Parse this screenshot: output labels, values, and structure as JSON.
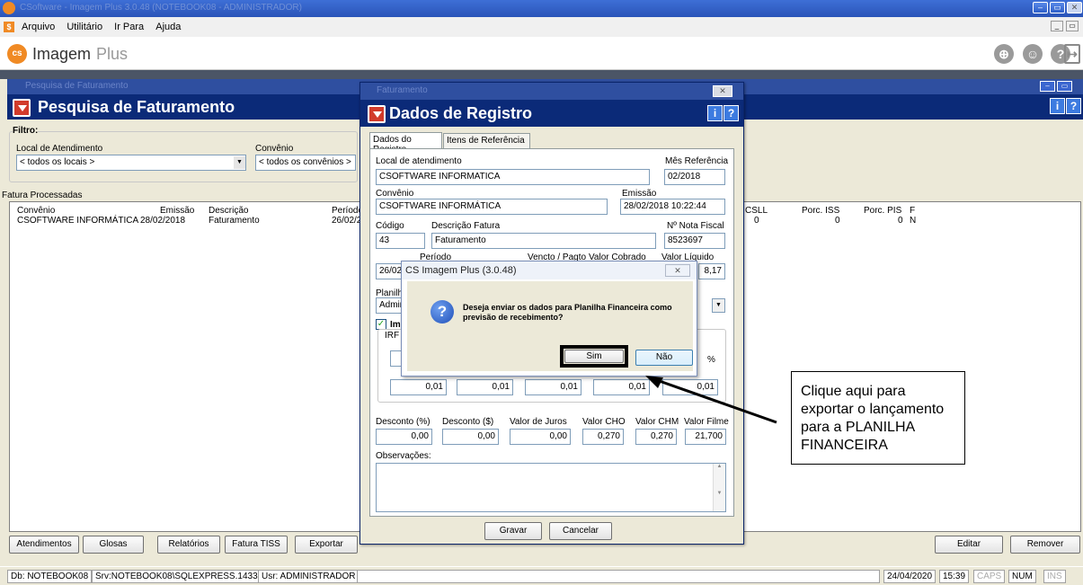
{
  "app": {
    "title": "CSoftware - Imagem Plus 3.0.48 (NOTEBOOK08 - ADMINISTRADOR)",
    "menu": [
      "Arquivo",
      "Utilitário",
      "Ir Para",
      "Ajuda"
    ],
    "brand": "Imagem",
    "brand_suffix": "Plus",
    "brand_logo": "cs"
  },
  "main_window": {
    "window_title": "Pesquisa de Faturamento",
    "header": "Pesquisa de Faturamento",
    "filter_label": "Filtro:",
    "local_label": "Local de Atendimento",
    "local_value": "< todos os locais >",
    "convenio_label": "Convênio",
    "convenio_value": "< todos os convênios >",
    "grid_title": "Fatura Processadas",
    "columns_left": [
      "Convênio",
      "Emissão",
      "Descrição",
      "Período"
    ],
    "columns_right": [
      "CSLL",
      "Porc. ISS",
      "Porc. PIS",
      "F"
    ],
    "row_left": [
      "CSOFTWARE INFORMÁTICA",
      "28/02/2018",
      "Faturamento",
      "26/02/2"
    ],
    "row_right": [
      "0",
      "0",
      "0",
      "N"
    ],
    "buttons_left": [
      "Atendimentos",
      "Glosas",
      "Relatórios",
      "Fatura TISS",
      "Exportar"
    ],
    "buttons_right": [
      "Editar",
      "Remover"
    ]
  },
  "dialog": {
    "window_title": "Faturamento",
    "header": "Dados de Registro",
    "tabs": [
      "Dados do Registro",
      "Itens de Referência"
    ],
    "local_label": "Local de atendimento",
    "local_value": "CSOFTWARE INFORMATICA",
    "mes_label": "Mês Referência",
    "mes_value": "02/2018",
    "convenio_label": "Convênio",
    "convenio_value": "CSOFTWARE INFORMÁTICA",
    "emissao_label": "Emissão",
    "emissao_value": "28/02/2018 10:22:44",
    "codigo_label": "Código",
    "codigo_value": "43",
    "descricao_label": "Descrição Fatura",
    "descricao_value": "Faturamento",
    "nf_label": "Nº Nota Fiscal",
    "nf_value": "8523697",
    "periodo_label": "Período",
    "vencto_label": "Vencto / Pagto",
    "cobrado_label": "Valor Cobrado",
    "liquido_label": "Valor Líquido",
    "periodo_value": "26/02/",
    "liquido_value": "8,17",
    "planilha_label": "Planilha",
    "planilha_value": "Admini",
    "imposto_label": "Im",
    "irrf_label": "IRF",
    "pct_symbol": "%",
    "tax_values": [
      "0,01",
      "0,01",
      "0,01",
      "0,01",
      "0,01"
    ],
    "desconto_pct_label": "Desconto (%)",
    "desconto_pct": "0,00",
    "desconto_val_label": "Desconto ($)",
    "desconto_val": "0,00",
    "juros_label": "Valor de Juros",
    "juros": "0,00",
    "cho_label": "Valor CHO",
    "cho": "0,270",
    "chm_label": "Valor CHM",
    "chm": "0,270",
    "filme_label": "Valor Filme",
    "filme": "21,700",
    "obs_label": "Observações:",
    "save": "Gravar",
    "cancel": "Cancelar"
  },
  "messagebox": {
    "title": "CS Imagem Plus (3.0.48)",
    "message": "Deseja enviar os dados para Planilha Financeira como previsão de recebimento?",
    "yes": "Sim",
    "no": "Não"
  },
  "callout": {
    "text": "Clique aqui para exportar o lançamento para a PLANILHA FINANCEIRA"
  },
  "statusbar": {
    "db": "Db: NOTEBOOK08",
    "srv": "Srv:NOTEBOOK08\\SQLEXPRESS.1433",
    "usr": "Usr: ADMINISTRADOR",
    "date": "24/04/2020",
    "time": "15:39",
    "caps": "CAPS",
    "num": "NUM",
    "ins": "INS"
  },
  "colors": {
    "titlebar": "#2a54b8",
    "brand_orange": "#f08a24",
    "dialog_header": "#0b2a78",
    "highlight": "#000000"
  }
}
